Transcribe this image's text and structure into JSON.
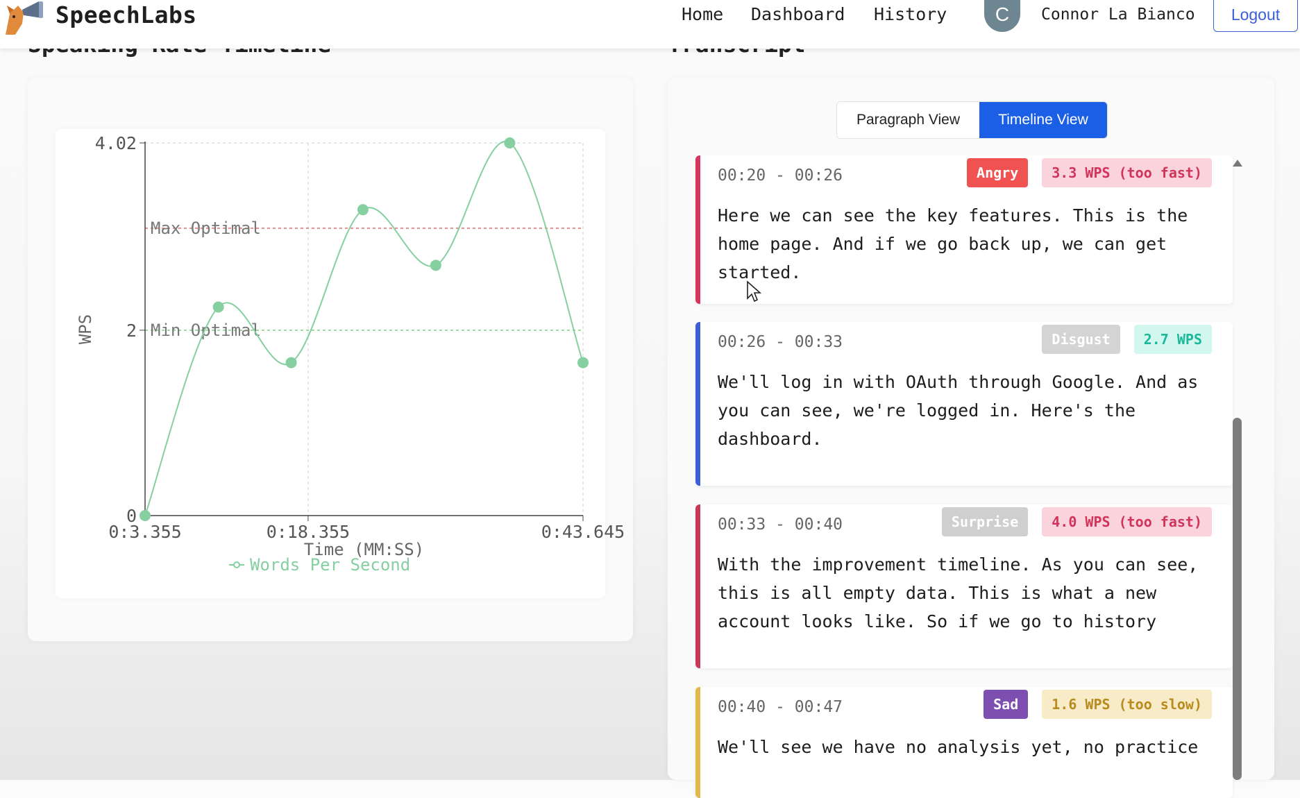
{
  "app": {
    "brand": "SpeechLabs"
  },
  "nav": {
    "links": [
      "Home",
      "Dashboard",
      "History"
    ],
    "avatar_initial": "C",
    "user_name": "Connor La Bianco",
    "logout_label": "Logout"
  },
  "sections": {
    "chart_title": "Speaking Rate Timeline",
    "transcript_title": "Transcript"
  },
  "transcript": {
    "views": [
      "Paragraph View",
      "Timeline View"
    ],
    "active_view": "Timeline View",
    "segments": [
      {
        "time": "00:20 - 00:26",
        "emotion": "Angry",
        "rate": "3.3 WPS (too fast)",
        "text": "Here we can see the key features. This is the home page. And if we go back up, we can get started.",
        "bar_color": "#d7355e",
        "emotion_bg": "#f05252",
        "emotion_fg": "#ffffff",
        "rate_bg": "#fbd3dc",
        "rate_fg": "#d0345a"
      },
      {
        "time": "00:26 - 00:33",
        "emotion": "Disgust",
        "rate": "2.7 WPS",
        "text": "We'll log in with OAuth through Google. And as you can see, we're logged in. Here's the dashboard.",
        "bar_color": "#3a5fd6",
        "emotion_bg": "#d4d4d4",
        "emotion_fg": "#ffffff",
        "rate_bg": "#d2f7ee",
        "rate_fg": "#1bb89a"
      },
      {
        "time": "00:33 - 00:40",
        "emotion": "Surprise",
        "rate": "4.0 WPS (too fast)",
        "text": "With the improvement timeline. As you can see, this is all empty data. This is what a new account looks like. So if we go to history",
        "bar_color": "#c93858",
        "emotion_bg": "#cfcfcf",
        "emotion_fg": "#ffffff",
        "rate_bg": "#fbd3dc",
        "rate_fg": "#d0345a"
      },
      {
        "time": "00:40 - 00:47",
        "emotion": "Sad",
        "rate": "1.6 WPS (too slow)",
        "text": "We'll see we have no analysis yet, no practice",
        "bar_color": "#e2b84a",
        "emotion_bg": "#7d4fb0",
        "emotion_fg": "#ffffff",
        "rate_bg": "#f7ebc8",
        "rate_fg": "#b98a1e"
      }
    ]
  },
  "chart_data": {
    "type": "line",
    "ylabel": "WPS",
    "xlabel": "Time (MM:SS)",
    "legend": "Words Per Second",
    "x_ticks": [
      "0:3.355",
      "0:18.355",
      "0:43.645"
    ],
    "y_ticks": [
      "0",
      "2",
      "4.02"
    ],
    "ylim": [
      0,
      4.02
    ],
    "reference_lines": [
      {
        "label": "Max Optimal",
        "value": 3.1,
        "color": "#e06a6a"
      },
      {
        "label": "Min Optimal",
        "value": 2.0,
        "color": "#7ccf7c"
      }
    ],
    "series": [
      {
        "values": [
          {
            "x": 3.355,
            "y": 0
          },
          {
            "x": 10.1,
            "y": 2.25
          },
          {
            "x": 16.8,
            "y": 1.65
          },
          {
            "x": 23.4,
            "y": 3.3
          },
          {
            "x": 30.1,
            "y": 2.7
          },
          {
            "x": 36.9,
            "y": 4.02
          },
          {
            "x": 43.645,
            "y": 1.65
          }
        ]
      }
    ],
    "line_color": "#86cfa0",
    "xlim": [
      3.355,
      43.645
    ]
  }
}
